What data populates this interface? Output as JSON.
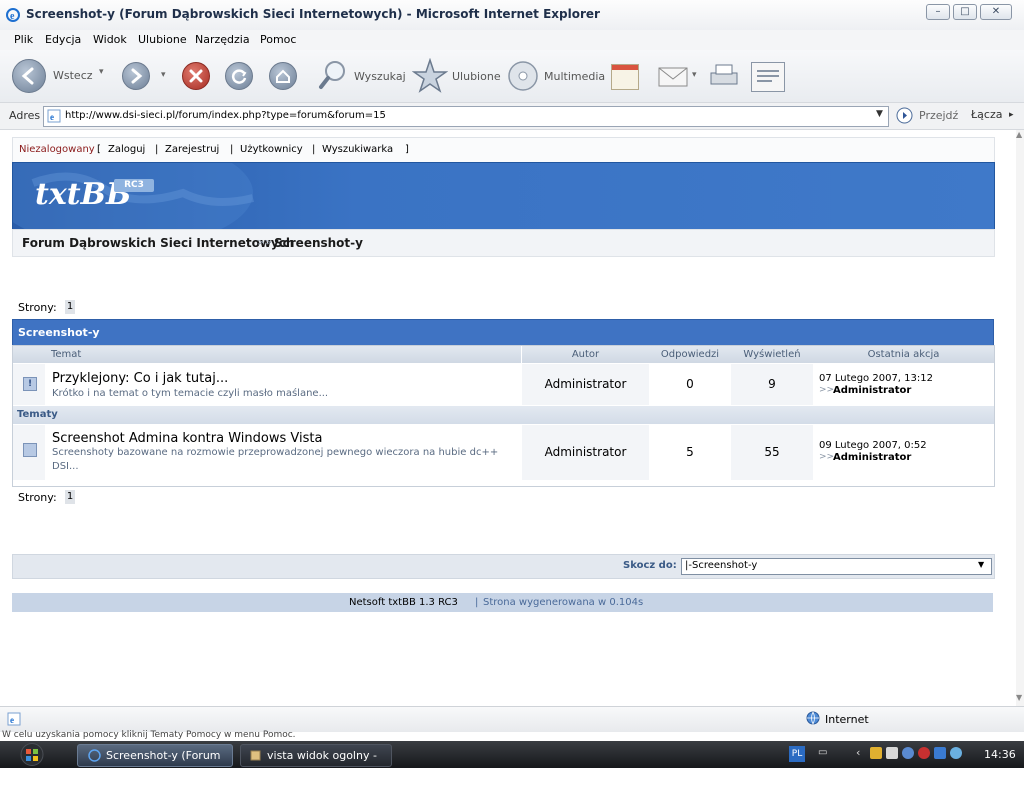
{
  "window": {
    "title": "Screenshot-y (Forum Dąbrowskich Sieci Internetowych) - Microsoft Internet Explorer",
    "min": "–",
    "max": "□",
    "close": "✕"
  },
  "menu": [
    "Plik",
    "Edycja",
    "Widok",
    "Ulubione",
    "Narzędzia",
    "Pomoc"
  ],
  "toolbar": {
    "back": "Wstecz",
    "search": "Wyszukaj",
    "favorites": "Ulubione",
    "multimedia": "Multimedia"
  },
  "address": {
    "label": "Adres",
    "url": "http://www.dsi-sieci.pl/forum/index.php?type=forum&forum=15",
    "go": "Przejdź",
    "links": "Łącza"
  },
  "forum": {
    "login": {
      "status": "Niezalogowany",
      "open": "[",
      "close": "]",
      "sep": "|",
      "links": [
        "Zaloguj",
        "Zarejestruj",
        "Użytkownicy",
        "Wyszukiwarka"
      ]
    },
    "logo": "txtBB",
    "badge": "RC3",
    "breadcrumb": {
      "root": "Forum Dąbrowskich Sieci Internetowych",
      "sep": ">>",
      "current": "Screenshot-y"
    },
    "pages_label": "Strony:",
    "page_num": "1",
    "header": "Screenshot-y",
    "columns": [
      "Temat",
      "Autor",
      "Odpowiedzi",
      "Wyświetleń",
      "Ostatnia akcja"
    ],
    "section_label": "Tematy",
    "sticky": {
      "title": "Przyklejony: Co i jak tutaj...",
      "desc": "Krótko i na temat o tym temacie czyli masło maślane...",
      "author": "Administrator",
      "replies": "0",
      "views": "9",
      "last_date": "07 Lutego 2007, 13:12",
      "last_arrow": ">>",
      "last_user": "Administrator"
    },
    "topics": [
      {
        "title": "Screenshot Admina kontra Windows Vista",
        "desc_line1": "Screenshoty bazowane na rozmowie przeprowadzonej pewnego wieczora na hubie dc++",
        "desc_line2": "DSI...",
        "author": "Administrator",
        "replies": "5",
        "views": "55",
        "last_date": "09 Lutego 2007, 0:52",
        "last_arrow": ">>",
        "last_user": "Administrator"
      }
    ],
    "jump_label": "Skocz do:",
    "jump_value": "|-Screenshot-y",
    "footer_name": "Netsoft txtBB 1.3 RC3",
    "footer_sep": "|",
    "footer_gen": "Strona wygenerowana w 0.104s"
  },
  "statusbar": {
    "zone": "Internet",
    "hint": "W celu uzyskania pomocy kliknij Tematy Pomocy w menu Pomoc."
  },
  "taskbar": {
    "tasks": [
      "Screenshot-y (Forum ...",
      "vista widok ogolny - P..."
    ],
    "lang": "PL",
    "clock": "14:36"
  },
  "icons": [
    "ie-icon",
    "back-icon",
    "forward-icon",
    "stop-icon",
    "refresh-icon",
    "home-icon",
    "search-icon",
    "favorites-star-icon",
    "multimedia-disc-icon",
    "history-icon",
    "mail-icon",
    "print-icon",
    "edit-icon",
    "go-arrow-icon",
    "sticky-topic-icon",
    "topic-icon",
    "dropdown-arrow-icon",
    "windows-start-icon",
    "globe-icon"
  ],
  "colors": {
    "forum_blue": "#3f73c3",
    "header_blue": "#2a5daa",
    "table_header": "#cfd8e3",
    "taskbar": "#16181b",
    "unauth_red": "#8b1a1a"
  }
}
